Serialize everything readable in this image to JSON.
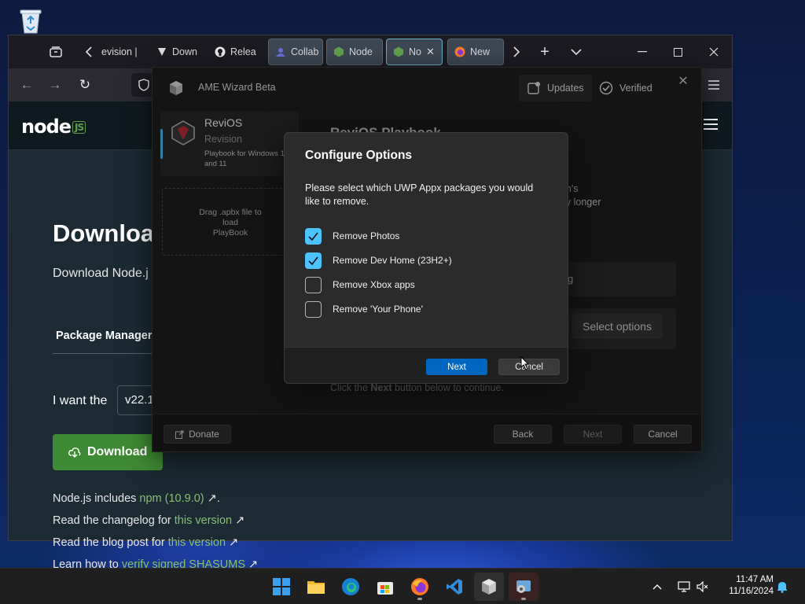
{
  "browser": {
    "tabs": [
      {
        "label": "evision |"
      },
      {
        "label": "Down"
      },
      {
        "label": "Relea"
      },
      {
        "label": "Collab"
      },
      {
        "label": "Node"
      },
      {
        "label": "No"
      },
      {
        "label": "New"
      }
    ]
  },
  "node": {
    "logo": "node",
    "logo_badge": "JS",
    "heading": "Downloa",
    "subheading": "Download Node.j",
    "package_manager": "Package Manager",
    "want": "I want the",
    "version": "v22.1",
    "download_btn": "Download",
    "npm_prefix": "Node.js includes ",
    "npm_link": "npm (10.9.0)",
    "npm_suffix": " ↗.",
    "changelog_prefix": "Read the changelog for ",
    "changelog_link": "this version",
    "blog_prefix": "Read the blog post for ",
    "blog_link": "this version",
    "shasums_prefix": "Learn how to ",
    "shasums_link": "verify signed SHASUMS",
    "arrow": " ↗"
  },
  "wizard": {
    "title": "AME Wizard Beta",
    "updates": "Updates",
    "verified": "Verified",
    "playbook_name": "ReviOS",
    "playbook_author": "Revision",
    "playbook_desc": "Playbook for Windows 10 and 11",
    "drop_line1": "Drag .apbx file to",
    "drop_line2": "load",
    "drop_line3": "PlayBook",
    "main_title": "ReviOS Playbook",
    "desc_line1": "tem's",
    "desc_line2": "any longer",
    "row_text": "g",
    "select_options": "Select options",
    "hint_prefix": "Click the ",
    "hint_bold": "Next",
    "hint_suffix": " button below to continue.",
    "donate": "Donate",
    "back": "Back",
    "next": "Next",
    "cancel": "Cancel"
  },
  "dialog": {
    "title": "Configure Options",
    "message": "Please select which UWP Appx packages you would like to remove.",
    "options": [
      {
        "label": "Remove Photos",
        "checked": true
      },
      {
        "label": "Remove Dev Home (23H2+)",
        "checked": true
      },
      {
        "label": "Remove Xbox apps",
        "checked": false
      },
      {
        "label": "Remove 'Your Phone'",
        "checked": false
      }
    ],
    "next": "Next",
    "cancel": "Cancel"
  },
  "taskbar": {
    "time": "11:47 AM",
    "date": "11/16/2024"
  },
  "colors": {
    "accent": "#4cc2ff",
    "primary_button": "#0067c0",
    "node_green": "#3f8a35",
    "link_green": "#86c06e"
  }
}
